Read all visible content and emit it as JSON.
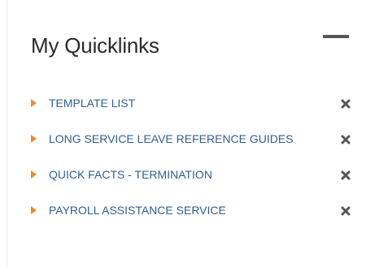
{
  "widget": {
    "title": "My Quicklinks",
    "collapse_icon": "minus-icon",
    "colors": {
      "title": "#2b2b2b",
      "link": "#2f5f94",
      "bullet": "#f08a24",
      "remove_icon": "#555555"
    }
  },
  "quicklinks": [
    {
      "label": "TEMPLATE LIST",
      "bullet_icon": "caret-right-icon",
      "remove_icon": "close-icon"
    },
    {
      "label": "LONG SERVICE LEAVE REFERENCE GUIDES",
      "bullet_icon": "caret-right-icon",
      "remove_icon": "close-icon"
    },
    {
      "label": "QUICK FACTS - TERMINATION",
      "bullet_icon": "caret-right-icon",
      "remove_icon": "close-icon"
    },
    {
      "label": "PAYROLL ASSISTANCE SERVICE",
      "bullet_icon": "caret-right-icon",
      "remove_icon": "close-icon"
    }
  ]
}
